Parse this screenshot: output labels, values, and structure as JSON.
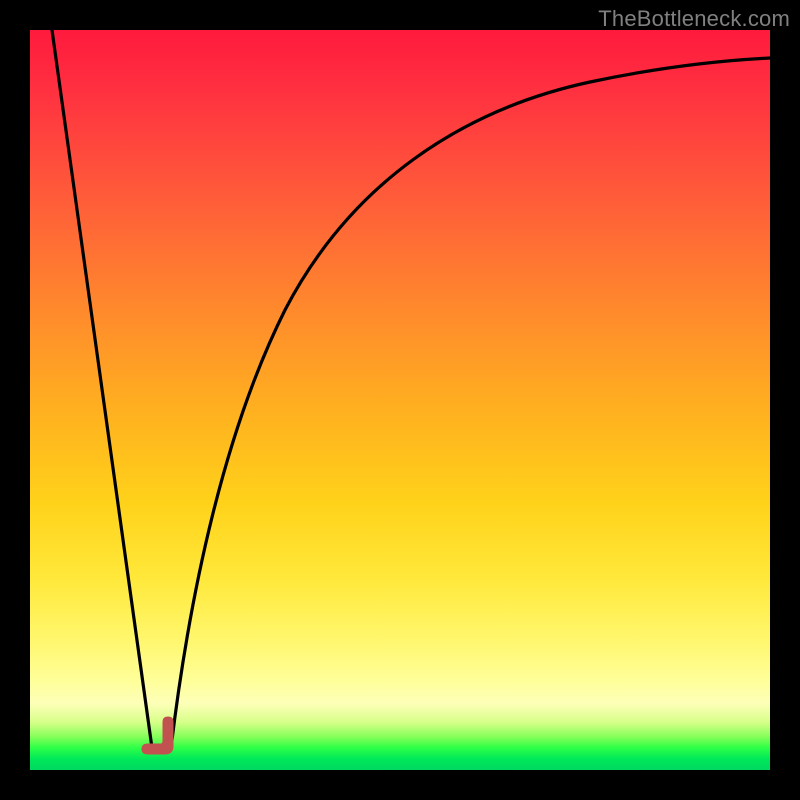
{
  "watermark": "TheBottleneck.com",
  "colors": {
    "frame": "#000000",
    "watermark": "#808080",
    "curve_stroke": "#000000",
    "marker_fill": "#c1524f",
    "marker_stroke": "#c1524f"
  },
  "chart_data": {
    "type": "line",
    "title": "",
    "xlabel": "",
    "ylabel": "",
    "xlim": [
      0,
      100
    ],
    "ylim": [
      0,
      100
    ],
    "grid": false,
    "legend": false,
    "note": "Axes have no visible ticks or labels. Values are read as percent of plot width/height with (0,0) at bottom-left.",
    "series": [
      {
        "name": "left-descending-line",
        "x": [
          3,
          16.5
        ],
        "y": [
          100,
          3
        ]
      },
      {
        "name": "right-rising-curve",
        "x": [
          19,
          22,
          26,
          30,
          36,
          44,
          54,
          66,
          80,
          92,
          100
        ],
        "y": [
          3,
          16,
          32,
          45,
          58,
          70,
          79,
          86,
          90.5,
          93,
          94
        ]
      }
    ],
    "markers": [
      {
        "name": "vertex-marker",
        "shape": "rounded-L",
        "x": 17.5,
        "y": 3,
        "approx_width_pct": 3.2,
        "approx_height_pct": 4
      }
    ]
  }
}
